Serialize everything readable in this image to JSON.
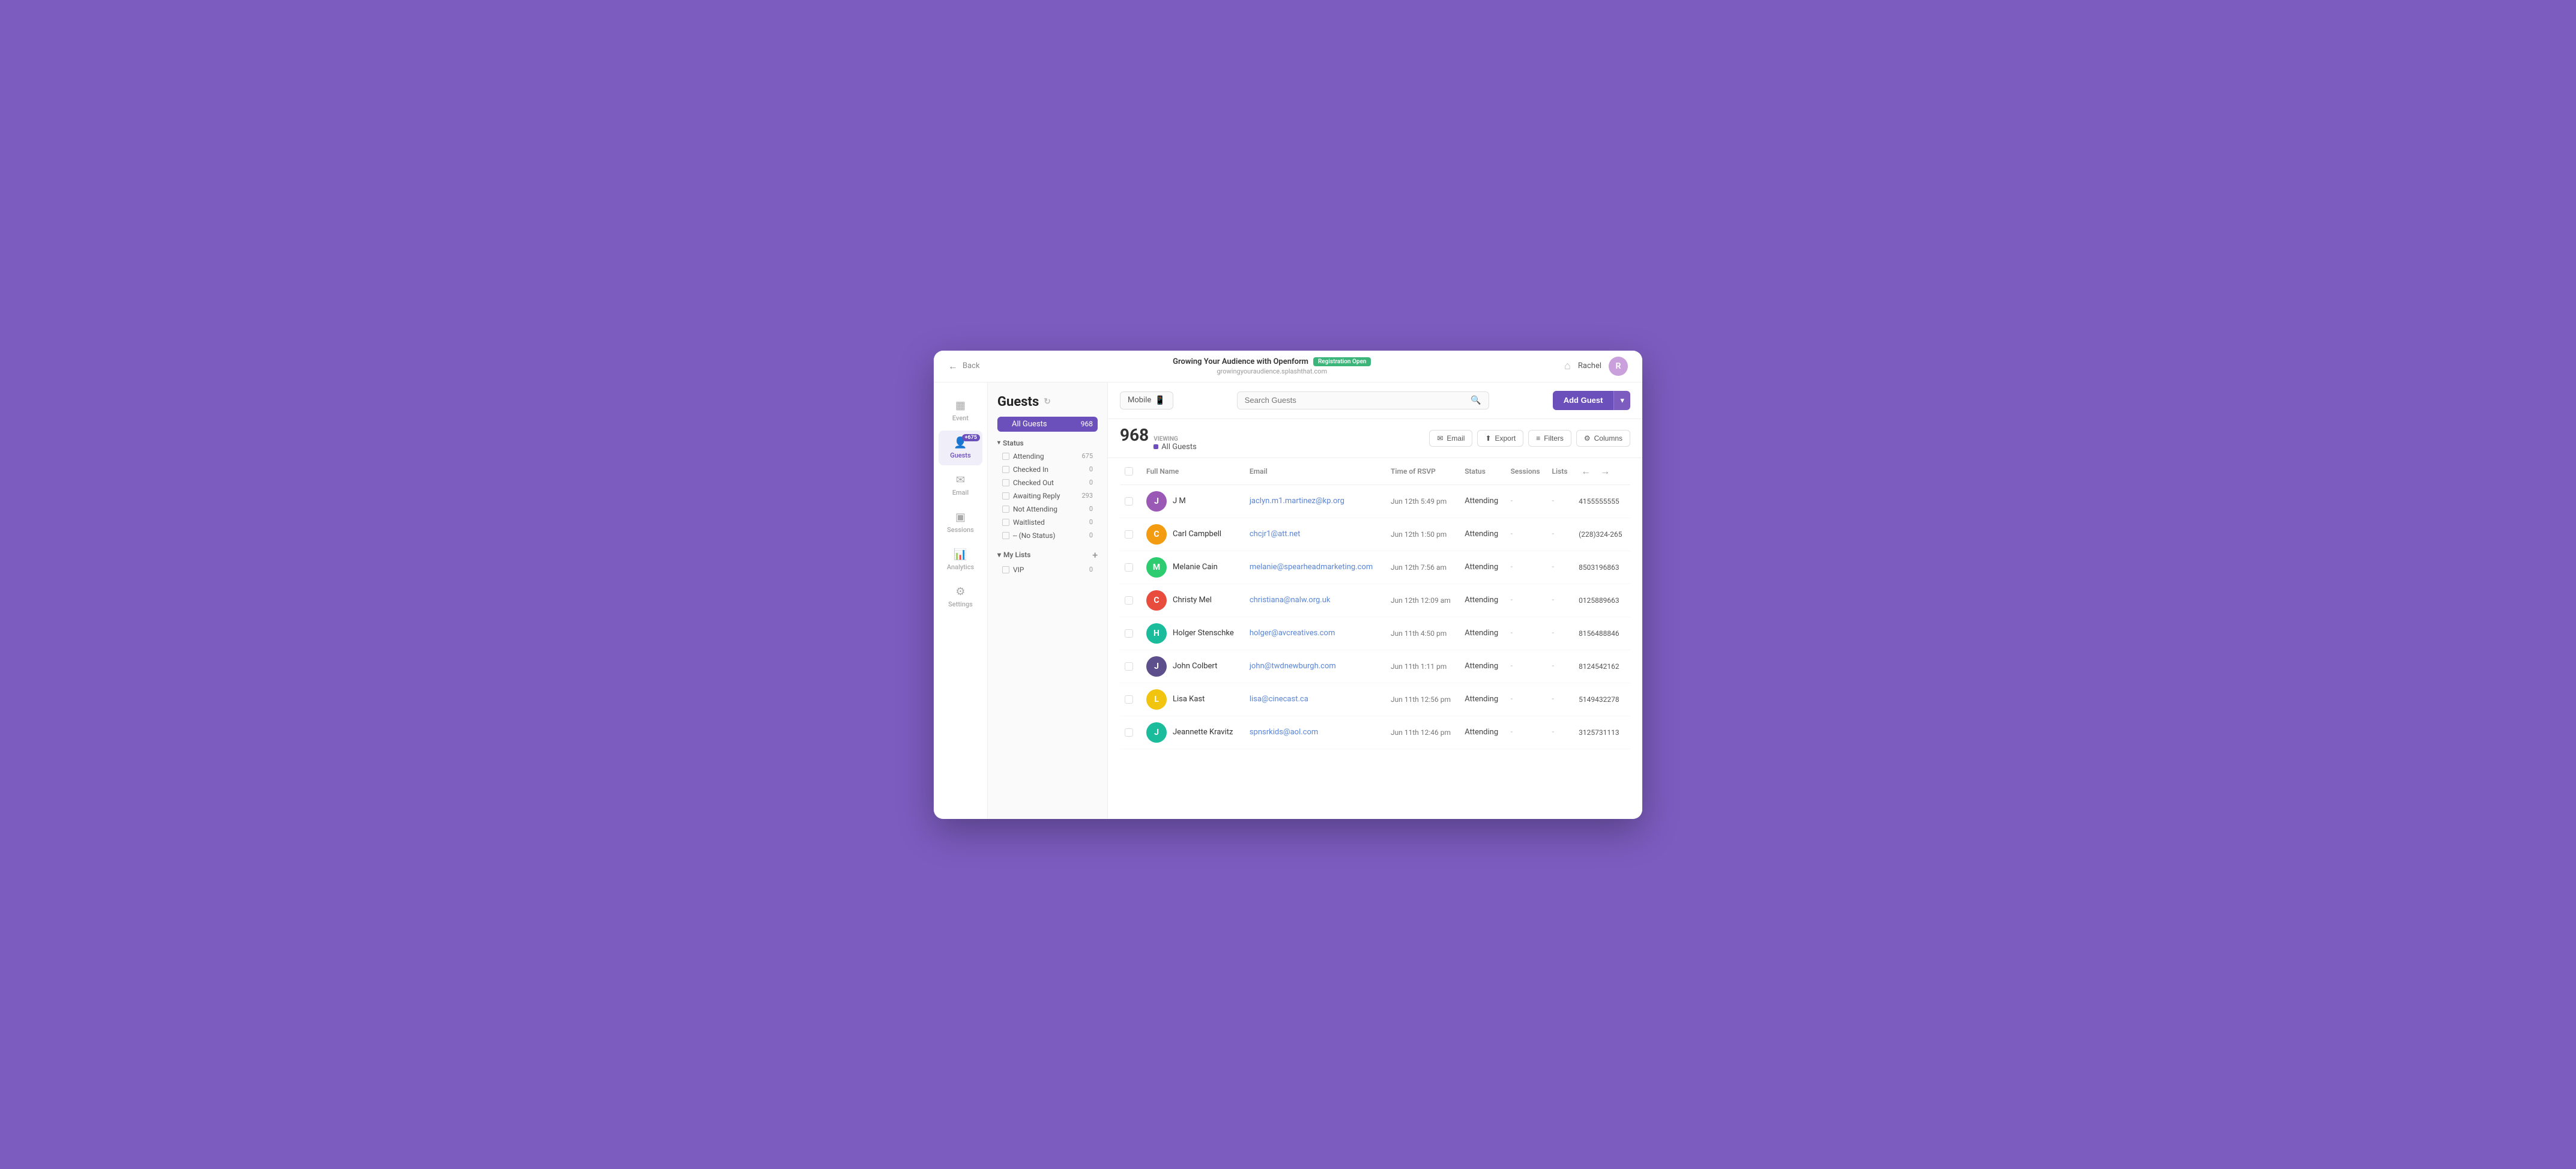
{
  "topBar": {
    "back_label": "Back",
    "event_title": "Growing Your Audience with Openform",
    "reg_badge": "Registration Open",
    "event_url": "growingyouraudience.splashthat.com",
    "user_name": "Rachel",
    "avatar_initial": "R"
  },
  "nav": {
    "items": [
      {
        "id": "event",
        "label": "Event",
        "icon": "▦",
        "active": false
      },
      {
        "id": "guests",
        "label": "Guests",
        "icon": "👤",
        "active": true,
        "badge": "+675"
      },
      {
        "id": "email",
        "label": "Email",
        "icon": "✉",
        "active": false
      },
      {
        "id": "sessions",
        "label": "Sessions",
        "icon": "▣",
        "active": false
      },
      {
        "id": "analytics",
        "label": "Analytics",
        "icon": "📊",
        "active": false
      },
      {
        "id": "settings",
        "label": "Settings",
        "icon": "⚙",
        "active": false
      }
    ]
  },
  "filterPanel": {
    "title": "Guests",
    "lists": [
      {
        "label": "All Guests",
        "count": 968,
        "active": true
      }
    ],
    "statusSection": {
      "header": "Status",
      "items": [
        {
          "label": "Attending",
          "count": 675
        },
        {
          "label": "Checked In",
          "count": 0
        },
        {
          "label": "Checked Out",
          "count": 0
        },
        {
          "label": "Awaiting Reply",
          "count": 293
        },
        {
          "label": "Not Attending",
          "count": 0
        },
        {
          "label": "Waitlisted",
          "count": 0
        },
        {
          "label": "-- (No Status)",
          "count": 0
        }
      ]
    },
    "myLists": {
      "header": "My Lists",
      "items": [
        {
          "label": "VIP",
          "count": 0
        }
      ]
    }
  },
  "contentTopBar": {
    "mobile_toggle_label": "Mobile",
    "search_placeholder": "Search Guests",
    "add_guest_label": "Add Guest"
  },
  "tableToolbar": {
    "count": "968",
    "viewing_label": "VIEWING",
    "viewing_value": "All Guests",
    "actions": [
      {
        "label": "Email",
        "icon": "✉"
      },
      {
        "label": "Export",
        "icon": "⬆"
      },
      {
        "label": "Filters",
        "icon": "≡"
      },
      {
        "label": "Columns",
        "icon": "⚙"
      }
    ]
  },
  "table": {
    "columns": [
      "",
      "Full Name",
      "Email",
      "Time of RSVP",
      "Status",
      "Sessions",
      "Lists",
      ""
    ],
    "rows": [
      {
        "initial": "J",
        "avatarColor": "#9b59b6",
        "name": "J M",
        "email": "jaclyn.m1.martinez@kp.org",
        "rsvp": "Jun 12th 5:49 pm",
        "status": "Attending",
        "sessions": "-",
        "lists": "-",
        "phone": "4155555555"
      },
      {
        "initial": "C",
        "avatarColor": "#f39c12",
        "name": "Carl Campbell",
        "email": "chcjr1@att.net",
        "rsvp": "Jun 12th 1:50 pm",
        "status": "Attending",
        "sessions": "-",
        "lists": "-",
        "phone": "(228)324-265"
      },
      {
        "initial": "M",
        "avatarColor": "#2ecc71",
        "name": "Melanie Cain",
        "email": "melanie@spearheadmarketing.com",
        "rsvp": "Jun 12th 7:56 am",
        "status": "Attending",
        "sessions": "-",
        "lists": "-",
        "phone": "8503196863"
      },
      {
        "initial": "C",
        "avatarColor": "#e74c3c",
        "name": "Christy Mel",
        "email": "christiana@nalw.org.uk",
        "rsvp": "Jun 12th 12:09 am",
        "status": "Attending",
        "sessions": "-",
        "lists": "-",
        "phone": "0125889663"
      },
      {
        "initial": "H",
        "avatarColor": "#1abc9c",
        "name": "Holger Stenschke",
        "email": "holger@avcreatives.com",
        "rsvp": "Jun 11th 4:50 pm",
        "status": "Attending",
        "sessions": "-",
        "lists": "-",
        "phone": "8156488846"
      },
      {
        "initial": "J",
        "avatarColor": "#5d4e8c",
        "name": "John Colbert",
        "email": "john@twdnewburgh.com",
        "rsvp": "Jun 11th 1:11 pm",
        "status": "Attending",
        "sessions": "-",
        "lists": "-",
        "phone": "8124542162"
      },
      {
        "initial": "L",
        "avatarColor": "#f1c40f",
        "name": "Lisa Kast",
        "email": "lisa@cinecast.ca",
        "rsvp": "Jun 11th 12:56 pm",
        "status": "Attending",
        "sessions": "-",
        "lists": "-",
        "phone": "5149432278"
      },
      {
        "initial": "J",
        "avatarColor": "#1abc9c",
        "name": "Jeannette Kravitz",
        "email": "spnsrkids@aol.com",
        "rsvp": "Jun 11th 12:46 pm",
        "status": "Attending",
        "sessions": "-",
        "lists": "-",
        "phone": "3125731113"
      }
    ]
  }
}
